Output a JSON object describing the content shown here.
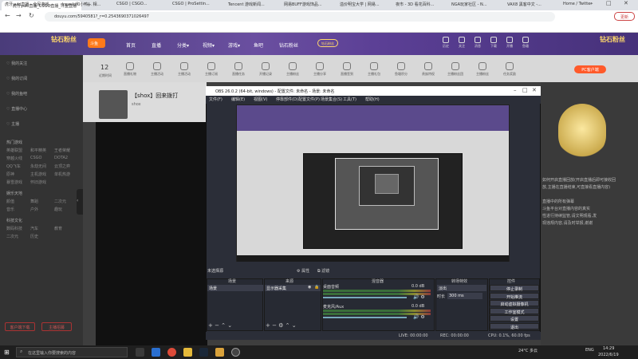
{
  "browser": {
    "tab_title": "虎牙yuki直播_CSGO直播_斗鱼直播",
    "url": "douyu.com/5940581?_r=0.2543690371026497",
    "update_label": "更新"
  },
  "bookmarks": [
    "虎牙yuki直播 - 全民游戏...",
    "drewski和小鸭... 相...",
    "CSGO | CSGO...",
    "CSGO | ProSettin...",
    "Tencent 游戏新闻...",
    "网易BUFF游戏饰品...",
    "溢价明宝大学 | 网易...",
    "夜市 - 3D 看花百科...",
    "NGA玩家社区 - N...",
    "VAX8 黑客中文 -...",
    "Home / Twitter"
  ],
  "site": {
    "logo": "钻石粉丝",
    "logo_right": "钻石粉丝",
    "douyu": "斗鱼",
    "nav": [
      "首页",
      "直播",
      "分类▾",
      "视频▾",
      "游戏▾",
      "鱼吧",
      "钻石粉丝"
    ],
    "banner_badge": "钻石粉丝",
    "header_icons": [
      "历史",
      "关注",
      "消息",
      "下载",
      "开播",
      "鱼塘"
    ],
    "top_count": "12",
    "top_count_label": "近期时间",
    "categories": [
      "直播礼物",
      "主播活动",
      "主播活动",
      "主播订阅",
      "直播任务",
      "开播记录",
      "主播粉丝",
      "主播分享",
      "直播签到",
      "主播礼包",
      "鱼塘积分",
      "贵族特权",
      "主播粉丝团",
      "主播粉丝",
      "任务奖励"
    ],
    "pc_button": "PC客户端",
    "stream_title": "【shox】回来拨打",
    "streamer": "shox",
    "right_text": [
      "如何开启直播回放(开启直播后即可接收回",
      "放,主播在直播结束,可直接看直播内容)",
      "",
      "直播中的所有弹幕",
      "斗鱼平台对直播内容的真实",
      "性进行持续监管,请文明观看,发",
      "现违规内容,请及时举报,谢谢"
    ]
  },
  "sidebar": {
    "items": [
      "我的关注",
      "我的订阅",
      "我的鱼吧",
      "直播中心",
      "主播"
    ],
    "groups": [
      {
        "title": "热门游戏",
        "items": [
          "英雄联盟",
          "和平精英",
          "王者荣耀",
          "穿越火线",
          "CSGO",
          "DOTA2",
          "QQ飞车",
          "永劫无间",
          "云顶之弈",
          "原神",
          "主机游戏",
          "单机热游",
          "暴雪游戏",
          "怀旧游戏"
        ]
      },
      {
        "title": "娱乐天地",
        "items": [
          "颜值",
          "舞蹈",
          "二次元",
          "音乐",
          "户外",
          "趣玩"
        ]
      },
      {
        "title": "科技文化",
        "items": [
          "数码科技",
          "汽车",
          "教育",
          "二次元",
          "历史"
        ]
      }
    ],
    "btn1": "客户端下载",
    "btn2": "主播招募"
  },
  "obs": {
    "title": "OBS 26.0.2 (64-bit, windows) - 配置文件: 未命名 - 场景: 未命名",
    "menu": [
      "文件(F)",
      "编辑(E)",
      "视图(V)",
      "停靠部件(D)",
      "配置文件(P)",
      "场景集合(S)",
      "工具(T)",
      "帮助(H)"
    ],
    "source_label": "未选择源",
    "props_label": "属性",
    "filter_label": "滤镜",
    "panels": {
      "scenes": "场景",
      "sources": "来源",
      "mixer": "混音器",
      "transitions": "转场特效",
      "controls": "控件"
    },
    "scene_item": "场景",
    "source_item": "显示器采集",
    "mixer": [
      {
        "name": "桌面音频",
        "db": "0.0 dB"
      },
      {
        "name": "麦克风/Aux",
        "db": "0.0 dB"
      }
    ],
    "transition": "淡出",
    "duration_label": "时长",
    "duration": "300 ms",
    "controls": [
      "停止录制",
      "开始推流",
      "启动虚拟摄像机",
      "工作室模式",
      "设置",
      "退出"
    ],
    "status": {
      "live": "LIVE: 00:00:00",
      "rec": "REC: 00:00:00",
      "cpu": "CPU: 0.1%, 60.00 fps"
    }
  },
  "taskbar": {
    "search_placeholder": "在这里输入你要搜索的内容",
    "weather": "24°C 多云",
    "lang": "ENG",
    "time": "14:29",
    "date": "2022/6/19"
  }
}
